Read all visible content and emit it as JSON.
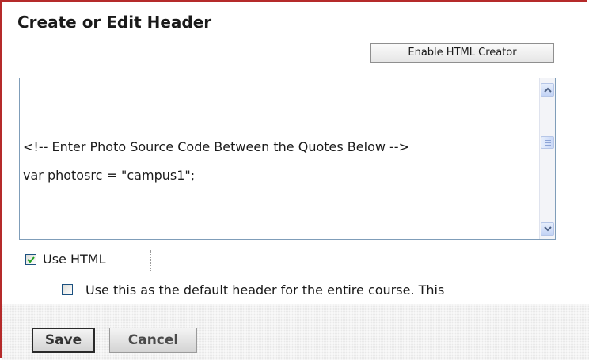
{
  "page": {
    "title": "Create or Edit Header"
  },
  "toolbar": {
    "html_creator_label": "Enable HTML Creator"
  },
  "editor": {
    "visible_lines": [
      "<!-- Enter Photo Source Code Between the Quotes Below -->",
      "var photosrc = \"campus1\";"
    ]
  },
  "options": {
    "use_html": {
      "label": "Use HTML",
      "checked": true
    },
    "default_header": {
      "label": "Use this as the default header for the entire course. This",
      "checked": false
    }
  },
  "footer": {
    "save_label": "Save",
    "cancel_label": "Cancel"
  },
  "colors": {
    "frame_border": "#b52a2a",
    "editor_border": "#7f9db9",
    "checkmark": "#21a121",
    "footer_bg": "#e9e9e9"
  },
  "icons": {
    "scroll_up": "chevron-up-icon",
    "scroll_down": "chevron-down-icon",
    "checkmark": "checkmark-icon"
  }
}
